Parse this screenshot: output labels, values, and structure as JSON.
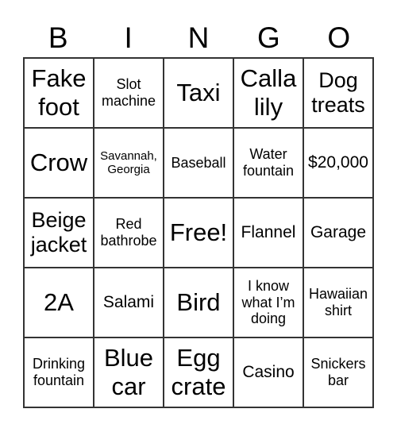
{
  "header": [
    "B",
    "I",
    "N",
    "G",
    "O"
  ],
  "cells": [
    [
      "Fake foot",
      "Slot machine",
      "Taxi",
      "Calla lily",
      "Dog treats"
    ],
    [
      "Crow",
      "Savannah, Georgia",
      "Baseball",
      "Water fountain",
      "$20,000"
    ],
    [
      "Beige jacket",
      "Red bathrobe",
      "Free!",
      "Flannel",
      "Garage"
    ],
    [
      "2A",
      "Salami",
      "Bird",
      "I know what I’m doing",
      "Hawaiian shirt"
    ],
    [
      "Drinking fountain",
      "Blue car",
      "Egg crate",
      "Casino",
      "Snickers bar"
    ]
  ]
}
